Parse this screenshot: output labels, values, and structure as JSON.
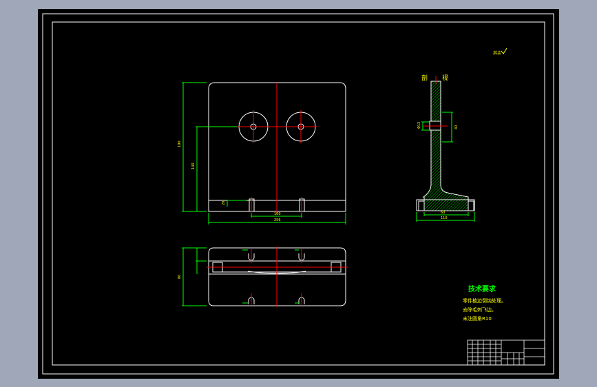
{
  "drawing": {
    "colors": {
      "background": "#9fa7b8",
      "sheet": "#000000",
      "frame": "#ffffff",
      "outline": "#ffffff",
      "dimension": "#00ff00",
      "centerline": "#ff0000",
      "hatch": "#00ff00",
      "annotation": "#ffff00"
    },
    "roughness_note": "其余",
    "section_labels": [
      "剖",
      "视"
    ],
    "dimensions": {
      "front_width": "256",
      "front_height": "190",
      "front_hole_height": "140",
      "front_slot_spacing": "100",
      "front_base_height": "20",
      "top_depth": "80",
      "side_base_width": "110",
      "side_base_inner": "60",
      "side_hole_spacing": "40",
      "side_hole_dia": "Φ12"
    },
    "technical_requirements": {
      "title": "技术要求",
      "items": [
        "零件棱边倒钝处理。",
        "去除毛刺飞边。",
        "未注圆角R10"
      ]
    },
    "title_block": {
      "part_name": "",
      "material": ""
    }
  }
}
